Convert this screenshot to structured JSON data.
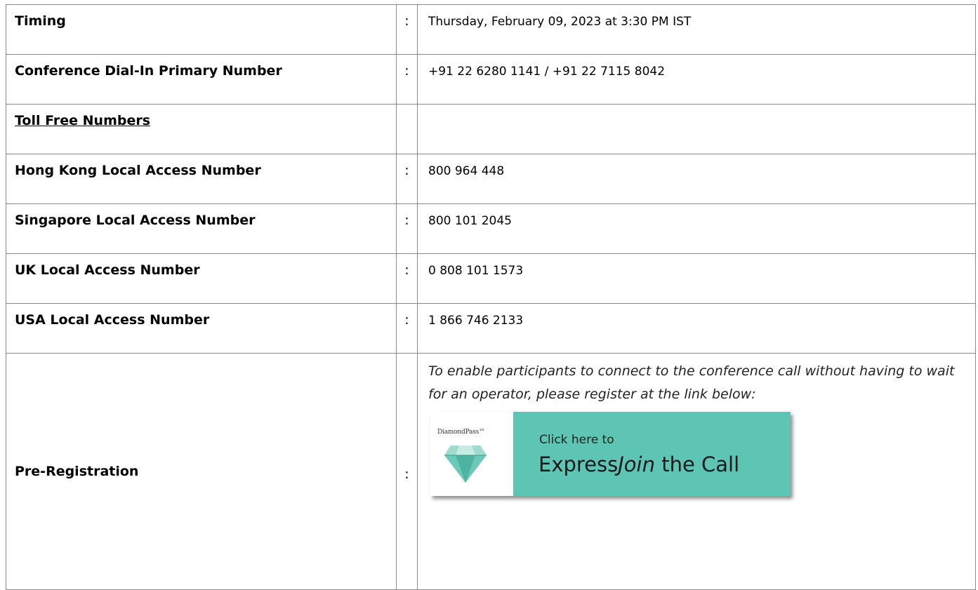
{
  "rows": [
    {
      "label": "Timing",
      "colon": ":",
      "value": "Thursday, February 09, 2023 at 3:30 PM IST"
    },
    {
      "label": "Conference Dial-In Primary Number",
      "colon": ":",
      "value": "+91 22 6280 1141 / +91 22 7115 8042"
    },
    {
      "label": "Toll Free Numbers",
      "colon": "",
      "value": ""
    },
    {
      "label": "Hong Kong Local Access Number",
      "colon": ":",
      "value": "800 964 448"
    },
    {
      "label": "Singapore Local Access Number",
      "colon": ":",
      "value": "800 101 2045"
    },
    {
      "label": "UK Local Access Number",
      "colon": ":",
      "value": "0 808 101 1573"
    },
    {
      "label": "USA Local Access Number",
      "colon": ":",
      "value": "1 866 746 2133"
    }
  ],
  "pre_registration": {
    "label": "Pre-Registration",
    "colon": ":",
    "text": "To enable participants to connect to the conference call without having to wait for an operator, please register at the link below:"
  },
  "banner": {
    "brand": "DiamondPass™",
    "click_text": "Click here to",
    "express_prefix": "Express",
    "express_italic": "Join",
    "express_suffix": " the Call",
    "icon": "diamond-icon",
    "colors": {
      "accent": "#5ec4b4",
      "diamond": "#6cc8b8"
    }
  }
}
